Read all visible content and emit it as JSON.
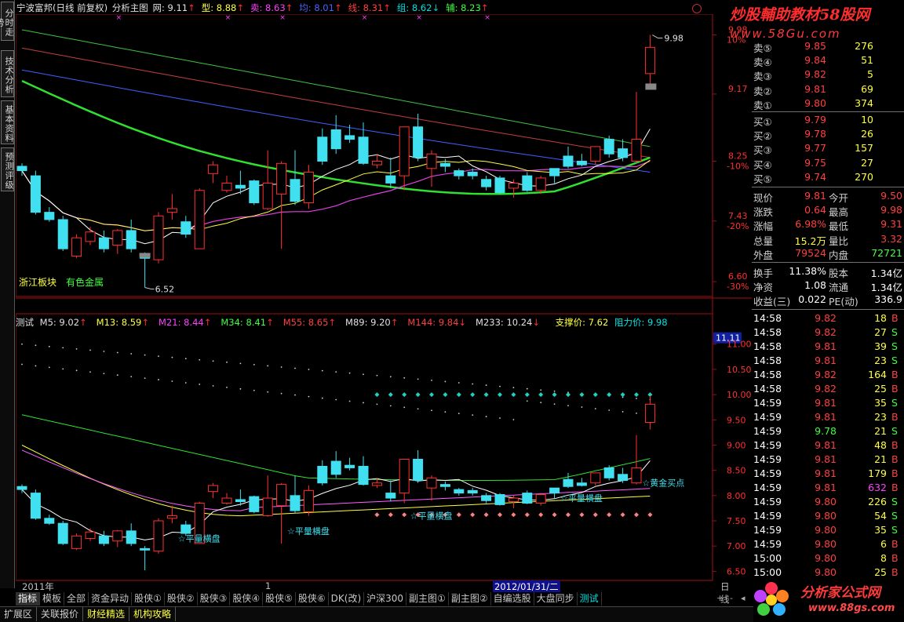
{
  "window": {
    "stock": "宁波富邦(日线 前复权)",
    "panel": "分析主图"
  },
  "left_tabs": [
    "分时走势",
    "技术分析",
    "基本资料",
    "预测评级"
  ],
  "header_items": [
    {
      "label": "网",
      "value": "9.11",
      "arrow": "↑",
      "color": "#e0e0e0"
    },
    {
      "label": "型",
      "value": "8.88",
      "arrow": "↑",
      "color": "#ffff40"
    },
    {
      "label": "卖",
      "value": "8.63",
      "arrow": "↑",
      "color": "#ff40ff"
    },
    {
      "label": "均",
      "value": "8.01",
      "arrow": "↑",
      "color": "#5060ff"
    },
    {
      "label": "线",
      "value": "8.31",
      "arrow": "↑",
      "color": "#ff4040"
    },
    {
      "label": "组",
      "value": "8.62",
      "arrow": "↓",
      "color": "#00e0e0"
    },
    {
      "label": "辅",
      "value": "8.23",
      "arrow": "↑",
      "color": "#40ff40"
    }
  ],
  "watermark_top": {
    "line1": "炒股輔助教材58股网",
    "line2": "www.58Gu.com"
  },
  "watermark_bottom": {
    "line1": "分析家公式网",
    "line2": "www.88gs.com"
  },
  "main_axis": [
    {
      "price": "9.98",
      "pct": "10%"
    },
    {
      "price": "9.17",
      "pct": ""
    },
    {
      "price": "8.25",
      "pct": "-10%"
    },
    {
      "price": "7.43",
      "pct": "-20%"
    },
    {
      "price": "6.60",
      "pct": "-30%"
    }
  ],
  "main_labels": {
    "sector": "浙江板块",
    "industry": "有色金属",
    "high_mark": "9.98",
    "low_mark": "6.52"
  },
  "sell_orders": [
    {
      "label": "卖⑤",
      "price": "9.85",
      "vol": "276"
    },
    {
      "label": "卖④",
      "price": "9.84",
      "vol": "51"
    },
    {
      "label": "卖③",
      "price": "9.82",
      "vol": "5"
    },
    {
      "label": "卖②",
      "price": "9.81",
      "vol": "69"
    },
    {
      "label": "卖①",
      "price": "9.80",
      "vol": "374"
    }
  ],
  "buy_orders": [
    {
      "label": "买①",
      "price": "9.79",
      "vol": "10"
    },
    {
      "label": "买②",
      "price": "9.78",
      "vol": "26"
    },
    {
      "label": "买③",
      "price": "9.77",
      "vol": "157"
    },
    {
      "label": "买④",
      "price": "9.75",
      "vol": "27"
    },
    {
      "label": "买⑤",
      "price": "9.74",
      "vol": "270"
    }
  ],
  "quote": [
    {
      "l1": "现价",
      "v1": "9.81",
      "l2": "今开",
      "v2": "9.50"
    },
    {
      "l1": "涨跌",
      "v1": "0.64",
      "l2": "最高",
      "v2": "9.98"
    },
    {
      "l1": "涨幅",
      "v1": "6.98%",
      "l2": "最低",
      "v2": "9.31"
    },
    {
      "l1": "总量",
      "v1": "15.2万",
      "l2": "量比",
      "v2": "3.32"
    },
    {
      "l1": "外盘",
      "v1": "79524",
      "l2": "内盘",
      "v2": "72721"
    }
  ],
  "quote2": [
    {
      "l1": "换手",
      "v1": "11.38%",
      "l2": "股本",
      "v2": "1.34亿"
    },
    {
      "l1": "净资",
      "v1": "1.08",
      "l2": "流通",
      "v2": "1.34亿"
    },
    {
      "l1": "收益(三)",
      "v1": "0.022",
      "l2": "PE(动)",
      "v2": "336.9"
    }
  ],
  "ticks": [
    {
      "t": "14:58",
      "p": "9.82",
      "v": "18",
      "s": "B"
    },
    {
      "t": "14:58",
      "p": "9.82",
      "v": "27",
      "s": "S"
    },
    {
      "t": "14:58",
      "p": "9.81",
      "v": "39",
      "s": "S"
    },
    {
      "t": "14:58",
      "p": "9.81",
      "v": "23",
      "s": "S"
    },
    {
      "t": "14:58",
      "p": "9.82",
      "v": "164",
      "s": "B"
    },
    {
      "t": "14:58",
      "p": "9.82",
      "v": "25",
      "s": "B"
    },
    {
      "t": "14:59",
      "p": "9.81",
      "v": "35",
      "s": "S"
    },
    {
      "t": "14:59",
      "p": "9.81",
      "v": "23",
      "s": "B"
    },
    {
      "t": "14:59",
      "p": "9.78",
      "v": "21",
      "s": "S"
    },
    {
      "t": "14:59",
      "p": "9.81",
      "v": "48",
      "s": "B"
    },
    {
      "t": "14:59",
      "p": "9.81",
      "v": "21",
      "s": "B"
    },
    {
      "t": "14:59",
      "p": "9.81",
      "v": "179",
      "s": "B"
    },
    {
      "t": "14:59",
      "p": "9.81",
      "v": "632",
      "s": "B"
    },
    {
      "t": "14:59",
      "p": "9.80",
      "v": "226",
      "s": "S"
    },
    {
      "t": "14:59",
      "p": "9.80",
      "v": "54",
      "s": "S"
    },
    {
      "t": "14:59",
      "p": "9.80",
      "v": "35",
      "s": "S"
    },
    {
      "t": "14:59",
      "p": "9.80",
      "v": "6",
      "s": "B"
    },
    {
      "t": "15:00",
      "p": "9.80",
      "v": "8",
      "s": "B"
    },
    {
      "t": "15:00",
      "p": "9.80",
      "v": "25",
      "s": "B"
    }
  ],
  "indicator_label": {
    "name": "测试",
    "items": [
      {
        "k": "M5",
        "v": "9.02",
        "arrow": "↑",
        "color": "#e0e0e0"
      },
      {
        "k": "M13",
        "v": "8.59",
        "arrow": "↑",
        "color": "#ffff40"
      },
      {
        "k": "M21",
        "v": "8.44",
        "arrow": "↑",
        "color": "#ff40ff"
      },
      {
        "k": "M34",
        "v": "8.41",
        "arrow": "↑",
        "color": "#40ff40"
      },
      {
        "k": "M55",
        "v": "8.65",
        "arrow": "↑",
        "color": "#ff4040"
      },
      {
        "k": "M89",
        "v": "9.20",
        "arrow": "↑",
        "color": "#e0e0e0"
      },
      {
        "k": "M144",
        "v": "9.84",
        "arrow": "↓",
        "color": "#ff4040"
      },
      {
        "k": "M233",
        "v": "10.24",
        "arrow": "↓",
        "color": "#e0e0e0"
      }
    ],
    "support": "支撑价: 7.62",
    "resist": "阻力价: 9.98"
  },
  "lower_axis": [
    "11.11",
    "11.00",
    "10.50",
    "10.00",
    "9.50",
    "9.00",
    "8.50",
    "8.00",
    "7.50",
    "7.00",
    "6.50"
  ],
  "lower_marks": [
    "☆平量横盘",
    "☆平量横盘",
    "☆平量横盘",
    "☆平量横盘",
    "☆黄金买点"
  ],
  "dates": {
    "start": "2011年",
    "mid": "1",
    "cursor": "2012/01/31/二",
    "period": "日线"
  },
  "bottom_tabs": [
    "指标",
    "模板",
    "全部",
    "资金异动",
    "股侠①",
    "股侠②",
    "股侠③",
    "股侠④",
    "股侠⑤",
    "股侠⑥",
    "DK(改)",
    "沪深300",
    "副主图①",
    "副主图②",
    "自编选股",
    "大盘同步",
    "测试"
  ],
  "status_tabs": [
    "扩展区",
    "关联报价",
    "财经精选",
    "机构攻略"
  ],
  "chart_data": {
    "type": "candlestick",
    "title": "宁波富邦(日线 前复权)",
    "ylim": [
      6.52,
      9.98
    ],
    "candles": [
      [
        8.18,
        8.12,
        8.22,
        8.05
      ],
      [
        8.05,
        7.55,
        8.12,
        7.52
      ],
      [
        7.55,
        7.45,
        7.62,
        7.42
      ],
      [
        7.45,
        7.05,
        7.5,
        7.02
      ],
      [
        6.95,
        7.2,
        7.25,
        6.92
      ],
      [
        7.15,
        7.28,
        7.35,
        7.1
      ],
      [
        7.2,
        7.05,
        7.3,
        7.0
      ],
      [
        7.1,
        7.3,
        7.32,
        6.98
      ],
      [
        7.3,
        7.05,
        7.45,
        7.0
      ],
      [
        6.95,
        6.92,
        7.0,
        6.52
      ],
      [
        6.9,
        7.5,
        7.55,
        6.85
      ],
      [
        7.55,
        7.6,
        7.8,
        7.45
      ],
      [
        7.42,
        7.25,
        7.5,
        7.2
      ],
      [
        7.05,
        7.85,
        7.88,
        7.05
      ],
      [
        8.08,
        8.2,
        8.25,
        7.95
      ],
      [
        7.85,
        7.95,
        8.05,
        7.82
      ],
      [
        7.92,
        7.88,
        8.12,
        7.8
      ],
      [
        7.98,
        7.68,
        8.0,
        7.65
      ],
      [
        7.6,
        7.95,
        8.4,
        7.58
      ],
      [
        7.8,
        8.22,
        8.25,
        7.05
      ],
      [
        8.0,
        7.7,
        8.4,
        7.65
      ],
      [
        7.68,
        8.1,
        8.2,
        7.6
      ],
      [
        8.58,
        8.25,
        8.7,
        8.2
      ],
      [
        8.68,
        8.42,
        8.88,
        8.35
      ],
      [
        8.6,
        8.55,
        8.75,
        8.5
      ],
      [
        8.58,
        8.22,
        8.78,
        8.2
      ],
      [
        8.2,
        8.25,
        8.35,
        8.15
      ],
      [
        8.05,
        7.95,
        8.3,
        7.88
      ],
      [
        8.05,
        8.72,
        8.72,
        7.85
      ],
      [
        8.72,
        8.3,
        8.9,
        8.25
      ],
      [
        8.15,
        8.35,
        8.4,
        7.9
      ],
      [
        8.22,
        8.18,
        8.28,
        8.1
      ],
      [
        8.12,
        8.05,
        8.15,
        8.0
      ],
      [
        8.1,
        8.05,
        8.15,
        8.0
      ],
      [
        8.0,
        7.9,
        8.05,
        7.85
      ],
      [
        8.02,
        7.82,
        8.05,
        7.8
      ],
      [
        7.88,
        7.95,
        8.0,
        7.75
      ],
      [
        8.05,
        7.85,
        8.1,
        7.83
      ],
      [
        7.85,
        8.02,
        8.05,
        7.8
      ],
      [
        8.15,
        8.05,
        8.15,
        7.95
      ],
      [
        8.32,
        8.18,
        8.45,
        8.15
      ],
      [
        8.25,
        8.2,
        8.35,
        8.18
      ],
      [
        8.25,
        8.45,
        8.45,
        8.2
      ],
      [
        8.55,
        8.35,
        8.6,
        8.3
      ],
      [
        8.42,
        8.3,
        8.55,
        8.25
      ],
      [
        8.25,
        8.55,
        9.2,
        8.22
      ],
      [
        9.45,
        9.81,
        9.98,
        9.31
      ]
    ]
  }
}
